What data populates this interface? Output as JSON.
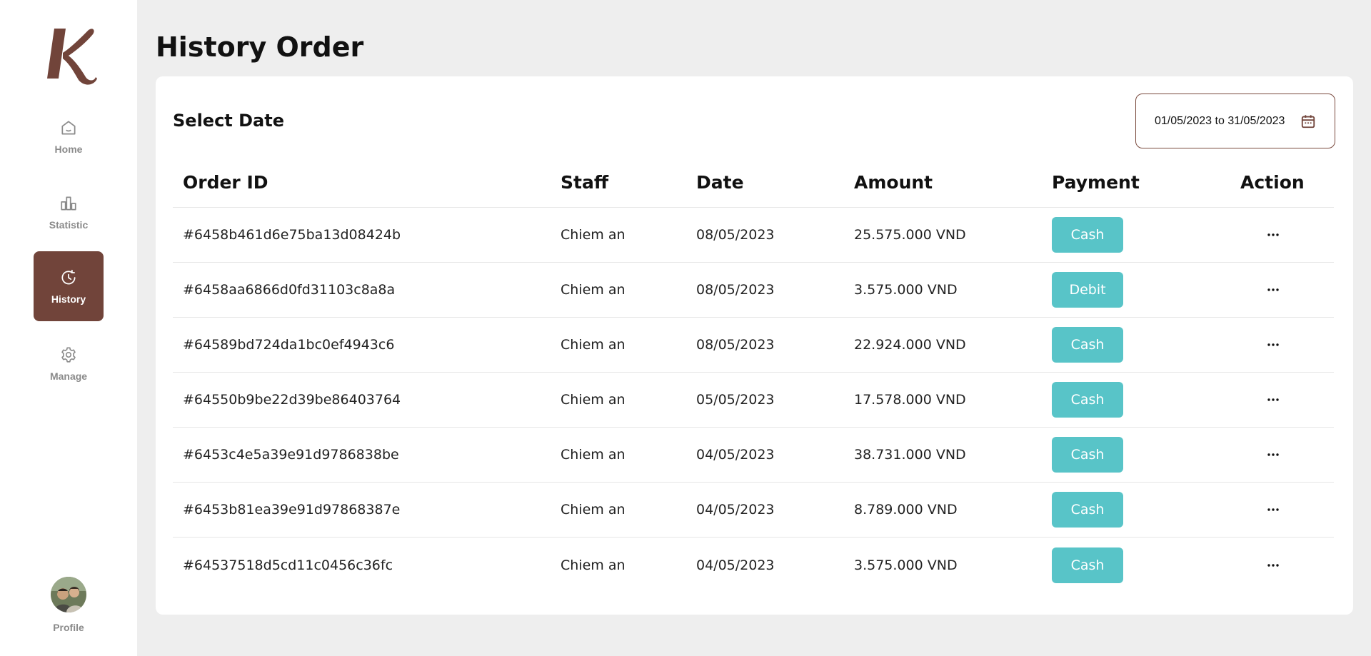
{
  "sidebar": {
    "logo_letter": "K",
    "items": [
      {
        "label": "Home",
        "icon": "home-icon"
      },
      {
        "label": "Statistic",
        "icon": "bar-chart-icon"
      },
      {
        "label": "History",
        "icon": "clock-icon",
        "active": true
      },
      {
        "label": "Manage",
        "icon": "gear-icon"
      }
    ],
    "profile_label": "Profile"
  },
  "page": {
    "title": "History Order"
  },
  "filter": {
    "label": "Select Date",
    "date_range": "01/05/2023 to 31/05/2023"
  },
  "table": {
    "headers": [
      "Order ID",
      "Staff",
      "Date",
      "Amount",
      "Payment",
      "Action"
    ],
    "rows": [
      {
        "id": "#6458b461d6e75ba13d08424b",
        "staff": "Chiem an",
        "date": "08/05/2023",
        "amount": "25.575.000 VND",
        "payment": "Cash"
      },
      {
        "id": "#6458aa6866d0fd31103c8a8a",
        "staff": "Chiem an",
        "date": "08/05/2023",
        "amount": "3.575.000 VND",
        "payment": "Debit"
      },
      {
        "id": "#64589bd724da1bc0ef4943c6",
        "staff": "Chiem an",
        "date": "08/05/2023",
        "amount": "22.924.000 VND",
        "payment": "Cash"
      },
      {
        "id": "#64550b9be22d39be86403764",
        "staff": "Chiem an",
        "date": "05/05/2023",
        "amount": "17.578.000 VND",
        "payment": "Cash"
      },
      {
        "id": "#6453c4e5a39e91d9786838be",
        "staff": "Chiem an",
        "date": "04/05/2023",
        "amount": "38.731.000 VND",
        "payment": "Cash"
      },
      {
        "id": "#6453b81ea39e91d97868387e",
        "staff": "Chiem an",
        "date": "04/05/2023",
        "amount": "8.789.000 VND",
        "payment": "Cash"
      },
      {
        "id": "#64537518d5cd11c0456c36fc",
        "staff": "Chiem an",
        "date": "04/05/2023",
        "amount": "3.575.000 VND",
        "payment": "Cash"
      }
    ]
  },
  "colors": {
    "brand": "#71443a",
    "payment_button": "#58c4c8",
    "background": "#eeeeee"
  }
}
